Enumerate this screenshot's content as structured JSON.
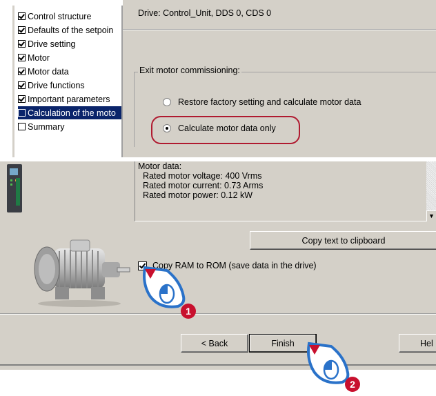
{
  "tree": {
    "items": [
      {
        "label": "Control structure",
        "checked": true,
        "selected": false
      },
      {
        "label": "Defaults of the setpoin",
        "checked": true,
        "selected": false
      },
      {
        "label": "Drive setting",
        "checked": true,
        "selected": false
      },
      {
        "label": "Motor",
        "checked": true,
        "selected": false
      },
      {
        "label": "Motor data",
        "checked": true,
        "selected": false
      },
      {
        "label": "Drive functions",
        "checked": true,
        "selected": false
      },
      {
        "label": "Important parameters",
        "checked": true,
        "selected": false
      },
      {
        "label": "Calculation of the moto",
        "checked": false,
        "selected": true
      },
      {
        "label": "Summary",
        "checked": false,
        "selected": false
      }
    ]
  },
  "drive_header": "Drive: Control_Unit, DDS 0, CDS 0",
  "exit_group": {
    "legend": "Exit motor commissioning:",
    "options": [
      {
        "label": "Restore factory setting and calculate motor data",
        "selected": false
      },
      {
        "label": "Calculate motor data only",
        "selected": true
      }
    ]
  },
  "motor_data_text": {
    "lines": [
      "Motor data:",
      "  Rated motor voltage: 400 Vrms",
      "  Rated motor current: 0.73 Arms",
      "  Rated motor power: 0.12 kW"
    ]
  },
  "copy_text_button": "Copy text to clipboard",
  "copy_ram": {
    "label": "Copy RAM to ROM (save data in the drive)",
    "checked": true
  },
  "buttons": {
    "back": "< Back",
    "finish": "Finish",
    "help": "Hel"
  },
  "badges": {
    "one": "1",
    "two": "2"
  },
  "colors": {
    "selection": "#0a246a",
    "highlight": "#b01a30",
    "badge_blue": "#2a72c9",
    "badge_red": "#c8102e"
  }
}
